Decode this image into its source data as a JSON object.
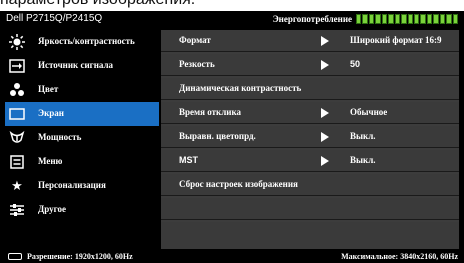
{
  "caption": "параметров изображения.",
  "header": {
    "model": "Dell P2715Q/P2415Q",
    "energy_label": "Энергопотребление",
    "energy_level": 1.0,
    "energy_color": "#7ad23a"
  },
  "menu": {
    "items": [
      {
        "label": "Яркость/контрастность",
        "icon": "brightness-icon"
      },
      {
        "label": "Источник сигнала",
        "icon": "input-source-icon"
      },
      {
        "label": "Цвет",
        "icon": "color-icon"
      },
      {
        "label": "Экран",
        "icon": "display-icon",
        "selected": true
      },
      {
        "label": "Мощность",
        "icon": "power-icon"
      },
      {
        "label": "Меню",
        "icon": "menu-icon"
      },
      {
        "label": "Персонализация",
        "icon": "star-icon"
      },
      {
        "label": "Другое",
        "icon": "other-settings-icon"
      }
    ],
    "selected_color": "#1a6fc4"
  },
  "settings": [
    {
      "key": "Формат",
      "value": "Широкий формат 16:9",
      "arrow": true
    },
    {
      "key": "Резкость",
      "value": "50",
      "arrow": true
    },
    {
      "key": "Динамическая контрастность",
      "value": "",
      "arrow": false
    },
    {
      "key": "Время отклика",
      "value": "Обычное",
      "arrow": true
    },
    {
      "key": "Выравн. цветопрд.",
      "value": "Выкл.",
      "arrow": true
    },
    {
      "key": "MST",
      "value": "Выкл.",
      "arrow": true
    },
    {
      "key": "Сброс настроек изображения",
      "value": "",
      "arrow": false
    },
    {
      "key": "",
      "value": "",
      "arrow": false
    },
    {
      "key": "",
      "value": "",
      "arrow": false
    }
  ],
  "status": {
    "resolution": "Разрешение: 1920x1200, 60Hz",
    "max": "Максимальное: 3840x2160, 60Hz"
  }
}
